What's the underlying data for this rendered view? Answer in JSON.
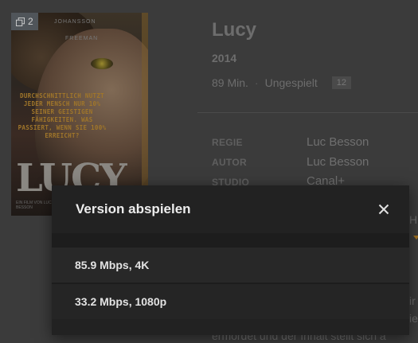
{
  "poster": {
    "count_badge": "2",
    "names_text": "JOHANSSON",
    "names_text_2": "FREEMAN",
    "tagline": "DURCHSCHNITTLICH NUTZT JEDER MENSCH NUR 10% SEINER GEISTIGEN FÄHIGKEITEN. WAS PASSIERT, WENN SIE 100% ERREICHT?",
    "big_title": "LUCY",
    "credits_small": "EIN FILM VON LUC BESSON"
  },
  "movie": {
    "title": "Lucy",
    "year": "2014",
    "runtime": "89 Min.",
    "separator": "·",
    "watch_status": "Ungespielt",
    "rating": "12"
  },
  "credits": [
    {
      "label": "REGIE",
      "value": "Luc Besson"
    },
    {
      "label": "AUTOR",
      "value": "Luc Besson"
    },
    {
      "label": "STUDIO",
      "value": "Canal+"
    }
  ],
  "background_text": {
    "right_cut_1": "H",
    "right_cut_2": "ir",
    "right_cut_3": "ie",
    "summary_cut": "ermordet und der Inhalt stellt sich a"
  },
  "modal": {
    "title": "Version abspielen",
    "close_icon": "close-icon",
    "options": [
      {
        "label": "85.9 Mbps, 4K"
      },
      {
        "label": "33.2 Mbps, 1080p"
      }
    ]
  },
  "colors": {
    "background": "#3b3b3b",
    "modal": "#222222",
    "accent": "#a07020"
  }
}
